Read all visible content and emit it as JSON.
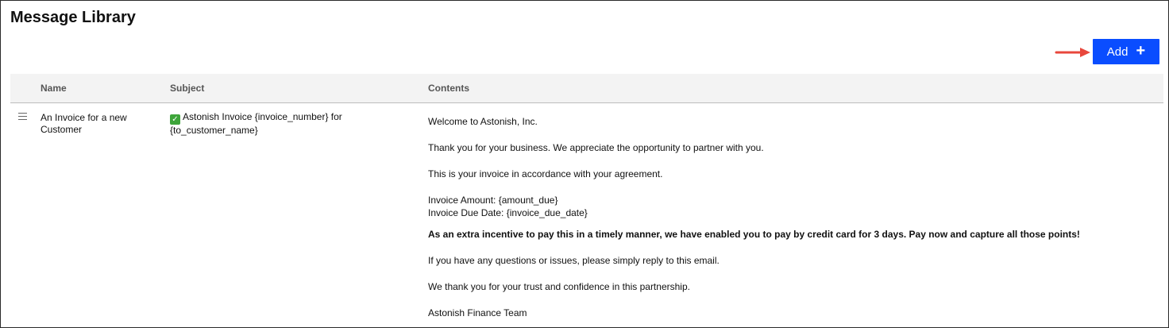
{
  "page": {
    "title": "Message Library"
  },
  "toolbar": {
    "add_label": "Add",
    "add_icon": "plus-icon",
    "accent": "#0a4dff",
    "annotation_arrow_color": "#e8473c"
  },
  "table": {
    "columns": [
      "Name",
      "Subject",
      "Contents"
    ],
    "rows": [
      {
        "name": "An Invoice for a new Customer",
        "subject_icon": "check-mark-icon",
        "subject": "Astonish Invoice {invoice_number} for {to_customer_name}",
        "contents": {
          "p1": "Welcome to Astonish, Inc.",
          "p2": "Thank you for your business. We appreciate the opportunity to partner with you.",
          "p3": "This is your invoice in accordance with your agreement.",
          "p4a": "Invoice Amount: {amount_due}",
          "p4b": "Invoice Due Date: {invoice_due_date}",
          "p5": "As an extra incentive to pay this in a timely manner, we have enabled you to pay by credit card for 3 days. Pay now and capture all those points!",
          "p6": "If you have any questions or issues, please simply reply to this email.",
          "p7": "We thank you for your trust and confidence in this partnership.",
          "p8": "Astonish Finance Team"
        }
      }
    ]
  }
}
